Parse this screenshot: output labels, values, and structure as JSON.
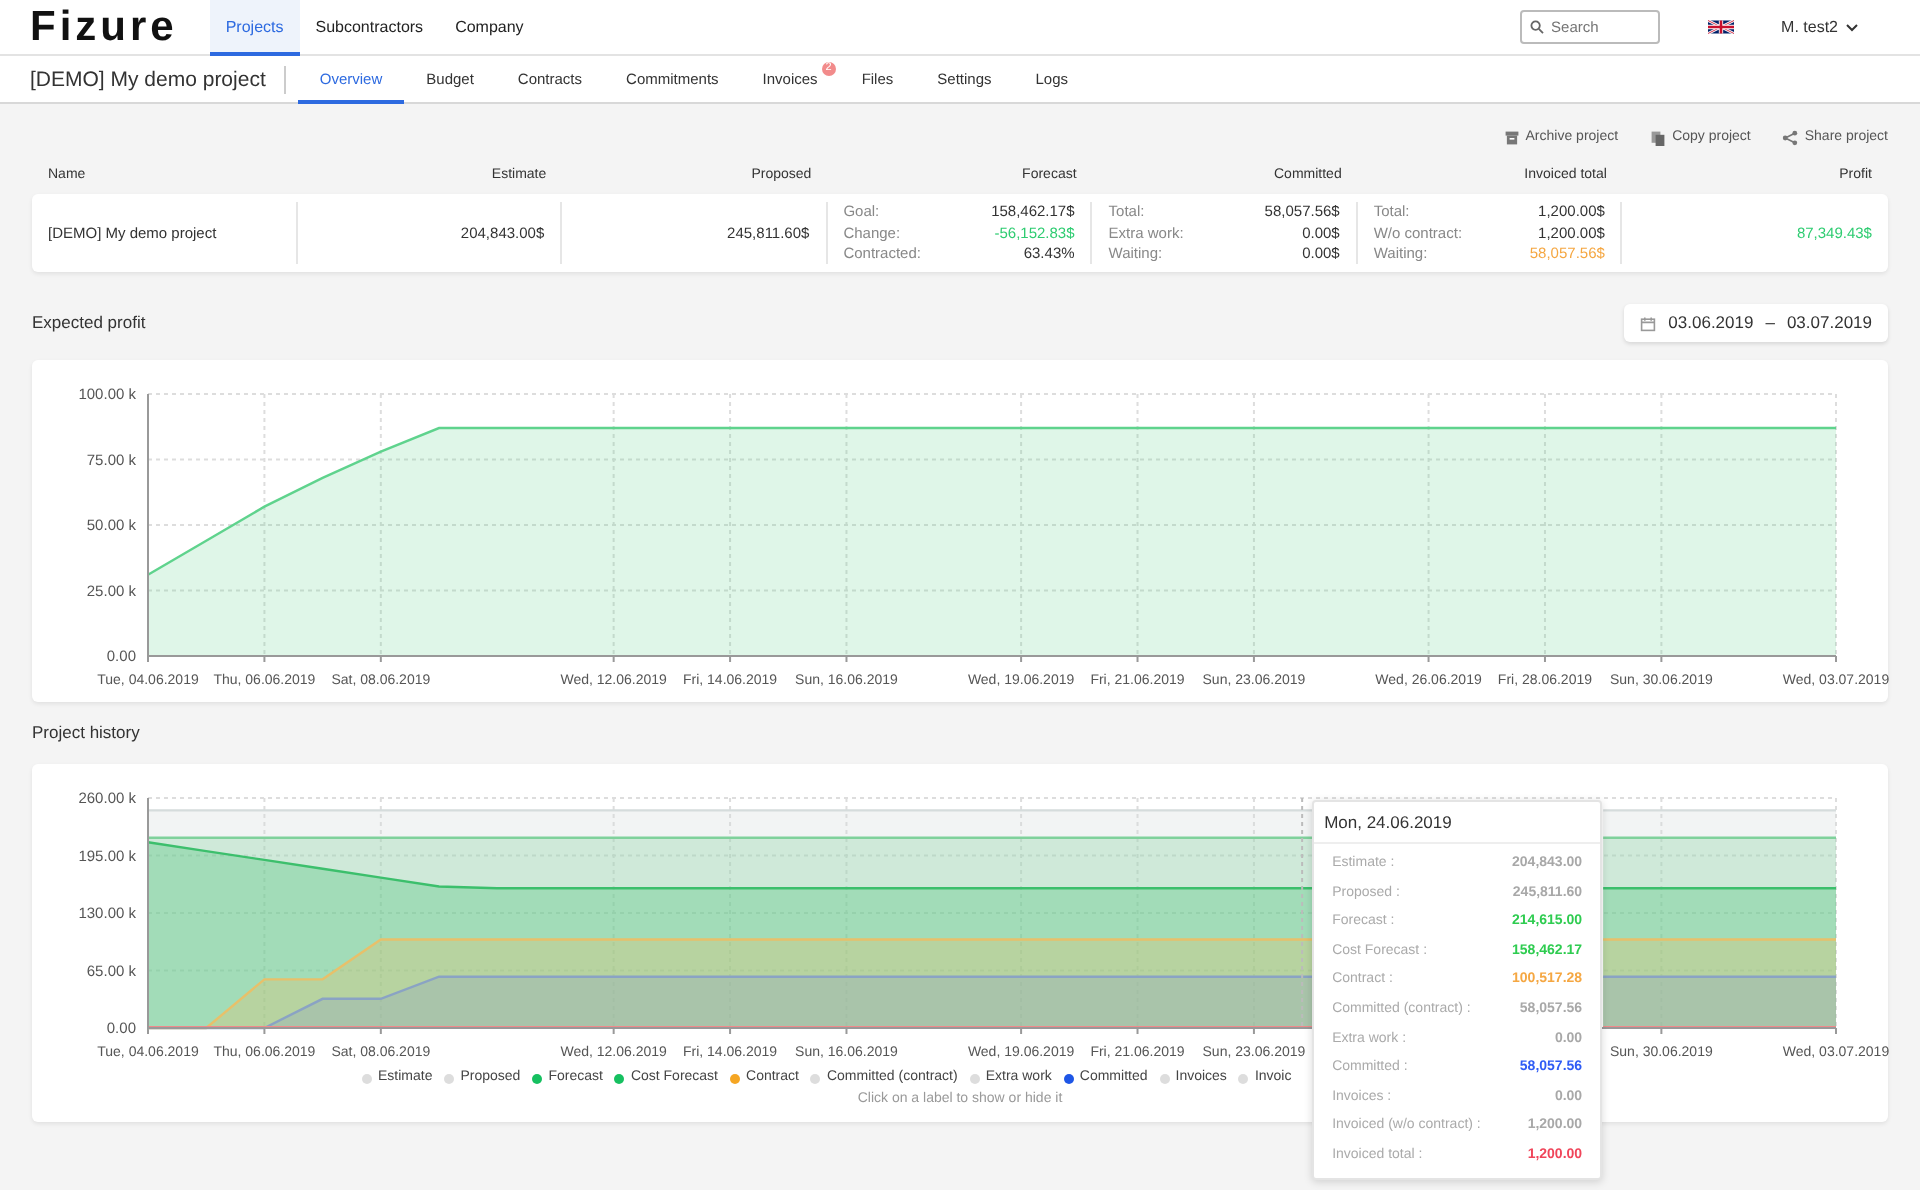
{
  "navbar": {
    "logo": "Fizure",
    "items": [
      {
        "label": "Projects",
        "selected": true
      },
      {
        "label": "Subcontractors",
        "selected": false
      },
      {
        "label": "Company",
        "selected": false
      }
    ],
    "search": {
      "placeholder": "Search"
    },
    "user": "M. test2"
  },
  "project_bar": {
    "title": "[DEMO] My demo project",
    "tabs": [
      {
        "label": "Overview",
        "selected": true
      },
      {
        "label": "Budget",
        "selected": false
      },
      {
        "label": "Contracts",
        "selected": false
      },
      {
        "label": "Commitments",
        "selected": false
      },
      {
        "label": "Invoices",
        "selected": false,
        "badge": "2"
      },
      {
        "label": "Files",
        "selected": false
      },
      {
        "label": "Settings",
        "selected": false
      },
      {
        "label": "Logs",
        "selected": false
      }
    ]
  },
  "actions": [
    {
      "kind": "archive",
      "label": "Archive project"
    },
    {
      "kind": "copy",
      "label": "Copy project"
    },
    {
      "kind": "share",
      "label": "Share project"
    }
  ],
  "summary": {
    "columns": [
      "Name",
      "Estimate",
      "Proposed",
      "Forecast",
      "Committed",
      "Invoiced total",
      "Profit"
    ],
    "row": {
      "name": "[DEMO] My demo project",
      "estimate": "204,843.00$",
      "proposed": "245,811.60$",
      "forecast": [
        {
          "label": "Goal:",
          "value": "158,462.17$",
          "color": "#333333"
        },
        {
          "label": "Change:",
          "value": "-56,152.83$",
          "color": "#2ecc71"
        },
        {
          "label": "Contracted:",
          "value": "63.43%",
          "color": "#333333"
        }
      ],
      "committed": [
        {
          "label": "Total:",
          "value": "58,057.56$",
          "color": "#333333"
        },
        {
          "label": "Extra work:",
          "value": "0.00$",
          "color": "#333333"
        },
        {
          "label": "Waiting:",
          "value": "0.00$",
          "color": "#333333"
        }
      ],
      "invoiced_total": [
        {
          "label": "Total:",
          "value": "1,200.00$",
          "color": "#333333"
        },
        {
          "label": "W/o contract:",
          "value": "1,200.00$",
          "color": "#333333"
        },
        {
          "label": "Waiting:",
          "value": "58,057.56$",
          "color": "#f5a742"
        }
      ],
      "profit": "87,349.43$"
    }
  },
  "expected_profit": {
    "title": "Expected profit",
    "date_range": {
      "start": "03.06.2019",
      "separator": "–",
      "end": "03.07.2019"
    },
    "chart_data": {
      "type": "area",
      "categories": [
        "Tue, 04.06.2019",
        null,
        "Thu, 06.06.2019",
        null,
        "Sat, 08.06.2019",
        null,
        null,
        null,
        "Wed, 12.06.2019",
        null,
        "Fri, 14.06.2019",
        null,
        "Sun, 16.06.2019",
        null,
        null,
        "Wed, 19.06.2019",
        null,
        "Fri, 21.06.2019",
        null,
        "Sun, 23.06.2019",
        null,
        null,
        "Wed, 26.06.2019",
        null,
        "Fri, 28.06.2019",
        null,
        "Sun, 30.06.2019",
        null,
        null,
        "Wed, 03.07.2019"
      ],
      "series": [
        {
          "color": "#5fd38d",
          "values": [
            31000,
            44000,
            57000,
            68000,
            78000,
            87000,
            87000,
            87000,
            87000,
            87000,
            87000,
            87000,
            87000,
            87000,
            87000,
            87000,
            87000,
            87000,
            87000,
            87000,
            87000,
            87000,
            87000,
            87000,
            87000,
            87000,
            87000,
            87000,
            87000,
            87000
          ]
        }
      ],
      "grid": true,
      "ylim": [
        0,
        100000
      ],
      "yticks": [
        {
          "value": 0,
          "label": "0.00"
        },
        {
          "value": 25000,
          "label": "25.00 k"
        },
        {
          "value": 50000,
          "label": "50.00 k"
        },
        {
          "value": 75000,
          "label": "75.00 k"
        },
        {
          "value": 100000,
          "label": "100.00 k"
        }
      ]
    }
  },
  "project_history": {
    "title": "Project history",
    "chart_data": {
      "type": "area",
      "categories": [
        "Tue, 04.06.2019",
        null,
        "Thu, 06.06.2019",
        null,
        "Sat, 08.06.2019",
        null,
        null,
        null,
        "Wed, 12.06.2019",
        null,
        "Fri, 14.06.2019",
        null,
        "Sun, 16.06.2019",
        null,
        null,
        "Wed, 19.06.2019",
        null,
        "Fri, 21.06.2019",
        null,
        "Sun, 23.06.2019",
        null,
        null,
        null,
        null,
        null,
        null,
        "Sun, 30.06.2019",
        null,
        null,
        "Wed, 03.07.2019"
      ],
      "series": [
        {
          "color": "#d5dcdc",
          "values": [
            246000,
            246000,
            246000,
            246000,
            246000,
            246000,
            246000,
            246000,
            246000,
            246000,
            246000,
            246000,
            246000,
            246000,
            246000,
            246000,
            246000,
            246000,
            246000,
            246000,
            246000,
            null,
            null,
            null,
            null,
            246000,
            246000,
            246000,
            246000,
            246000
          ]
        },
        {
          "color": "#7fd19b",
          "values": [
            215000,
            215000,
            215000,
            215000,
            215000,
            215000,
            215000,
            215000,
            215000,
            215000,
            215000,
            215000,
            215000,
            215000,
            215000,
            215000,
            215000,
            215000,
            215000,
            215000,
            215000,
            null,
            null,
            null,
            null,
            215000,
            215000,
            215000,
            215000,
            215000
          ]
        },
        {
          "color": "#3cbf6c",
          "values": [
            210000,
            200000,
            190000,
            180000,
            170000,
            160000,
            158000,
            158000,
            158000,
            158000,
            158000,
            158000,
            158000,
            158000,
            158000,
            158000,
            158000,
            158000,
            158000,
            158000,
            158000,
            null,
            null,
            null,
            null,
            158000,
            158000,
            158000,
            158000,
            158000
          ]
        },
        {
          "color": "#e8c06a",
          "values": [
            0,
            0,
            55000,
            55000,
            100000,
            100000,
            100000,
            100000,
            100000,
            100000,
            100000,
            100000,
            100000,
            100000,
            100000,
            100000,
            100000,
            100000,
            100000,
            100000,
            100000,
            null,
            null,
            null,
            null,
            100000,
            100000,
            100000,
            100000,
            100000
          ]
        },
        {
          "color": "#8aa3c4",
          "values": [
            0,
            0,
            0,
            33000,
            33000,
            58000,
            58000,
            58000,
            58000,
            58000,
            58000,
            58000,
            58000,
            58000,
            58000,
            58000,
            58000,
            58000,
            58000,
            58000,
            58000,
            null,
            null,
            null,
            null,
            58000,
            58000,
            58000,
            58000,
            58000
          ]
        },
        {
          "color": "#f08a8a",
          "values": [
            1000,
            1000,
            1000,
            1000,
            1000,
            1000,
            1000,
            1000,
            1000,
            1000,
            1000,
            1000,
            1000,
            1000,
            1000,
            1000,
            1000,
            1000,
            1000,
            1000,
            1000,
            null,
            null,
            null,
            null,
            1000,
            1000,
            1000,
            1000,
            1000
          ]
        }
      ],
      "grid": true,
      "ylim": [
        0,
        260000
      ],
      "yticks": [
        {
          "value": 0,
          "label": "0.00"
        },
        {
          "value": 65000,
          "label": "65.00 k"
        },
        {
          "value": 130000,
          "label": "130.00 k"
        },
        {
          "value": 195000,
          "label": "195.00 k"
        },
        {
          "value": 260000,
          "label": "260.00 k"
        }
      ]
    },
    "legend": [
      {
        "label": "Estimate",
        "color": "#dddddd"
      },
      {
        "label": "Proposed",
        "color": "#dddddd"
      },
      {
        "label": "Forecast",
        "color": "#16c060"
      },
      {
        "label": "Cost Forecast",
        "color": "#16c060"
      },
      {
        "label": "Contract",
        "color": "#f5a623"
      },
      {
        "label": "Committed (contract)",
        "color": "#dddddd"
      },
      {
        "label": "Extra work",
        "color": "#dddddd"
      },
      {
        "label": "Committed",
        "color": "#1e56e6"
      },
      {
        "label": "Invoices",
        "color": "#dddddd"
      },
      {
        "label": "Invoic",
        "color": "#dddddd"
      }
    ],
    "hint": "Click on a label to show or hide it",
    "tooltip": {
      "title": "Mon, 24.06.2019",
      "rows": [
        {
          "label": "Estimate :",
          "value": "204,843.00",
          "color": "#a8a8a8"
        },
        {
          "label": "Proposed :",
          "value": "245,811.60",
          "color": "#a8a8a8"
        },
        {
          "label": "Forecast :",
          "value": "214,615.00",
          "color": "#2ecc50"
        },
        {
          "label": "Cost Forecast :",
          "value": "158,462.17",
          "color": "#2ecc50"
        },
        {
          "label": "Contract :",
          "value": "100,517.28",
          "color": "#f5a742"
        },
        {
          "label": "Committed (contract) :",
          "value": "58,057.56",
          "color": "#a8a8a8"
        },
        {
          "label": "Extra work :",
          "value": "0.00",
          "color": "#a8a8a8"
        },
        {
          "label": "Committed :",
          "value": "58,057.56",
          "color": "#2f5cf5"
        },
        {
          "label": "Invoices :",
          "value": "0.00",
          "color": "#a8a8a8"
        },
        {
          "label": "Invoiced (w/o contract) :",
          "value": "1,200.00",
          "color": "#a8a8a8"
        },
        {
          "label": "Invoiced total :",
          "value": "1,200.00",
          "color": "#f0455a"
        }
      ]
    }
  }
}
